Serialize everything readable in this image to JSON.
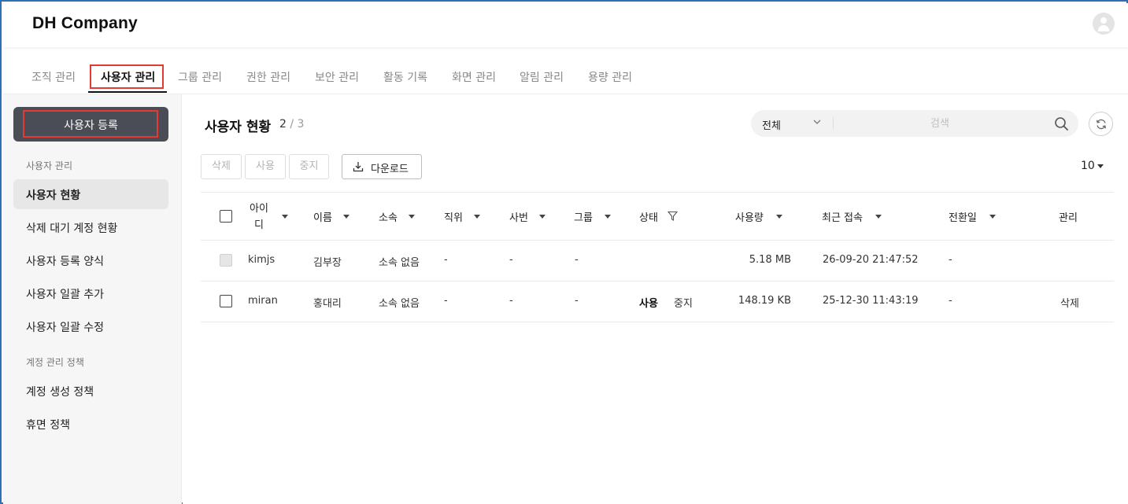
{
  "header": {
    "company": "DH Company"
  },
  "tabs": [
    {
      "label": "조직 관리"
    },
    {
      "label": "사용자 관리"
    },
    {
      "label": "그룹 관리"
    },
    {
      "label": "권한 관리"
    },
    {
      "label": "보안 관리"
    },
    {
      "label": "활동 기록"
    },
    {
      "label": "화면 관리"
    },
    {
      "label": "알림 관리"
    },
    {
      "label": "용량 관리"
    }
  ],
  "sidebar": {
    "register_button": "사용자 등록",
    "section1": "사용자 관리",
    "items1": [
      {
        "label": "사용자 현황"
      },
      {
        "label": "삭제 대기 계정 현황"
      },
      {
        "label": "사용자 등록 양식"
      },
      {
        "label": "사용자 일괄 추가"
      },
      {
        "label": "사용자 일괄 수정"
      }
    ],
    "section2": "계정 관리 정책",
    "items2": [
      {
        "label": "계정 생성 정책"
      },
      {
        "label": "휴면 정책"
      }
    ]
  },
  "main": {
    "title": "사용자 현황",
    "count_current": "2",
    "count_total": "/ 3",
    "search": {
      "filter_value": "전체",
      "placeholder": "검색"
    },
    "toolbar": {
      "delete_label": "삭제",
      "enable_label": "사용",
      "suspend_label": "중지",
      "download_label": "다운로드",
      "page_size": "10"
    },
    "table": {
      "columns": {
        "id_line1": "아이",
        "id_line2": "디",
        "name": "이름",
        "affiliation": "소속",
        "position": "직위",
        "employee_no": "사번",
        "group": "그룹",
        "status": "상태",
        "usage": "사용량",
        "last_access": "최근 접속",
        "transition_date": "전환일",
        "manage": "관리"
      },
      "rows": [
        {
          "id": "kimjs",
          "name": "김부장",
          "affiliation": "소속 없음",
          "position": "-",
          "employee_no": "-",
          "group": "-",
          "status": "",
          "status_action": "",
          "usage": "5.18 MB",
          "last_access": "26-09-20 21:47:52",
          "transition_date": "-",
          "manage": "",
          "checkbox_disabled": true
        },
        {
          "id": "miran",
          "name": "홍대리",
          "affiliation": "소속 없음",
          "position": "-",
          "employee_no": "-",
          "group": "-",
          "status": "사용",
          "status_action": "중지",
          "usage": "148.19 KB",
          "last_access": "25-12-30 11:43:19",
          "transition_date": "-",
          "manage": "삭제",
          "checkbox_disabled": false
        }
      ]
    }
  },
  "colors": {
    "highlight": "#e53935",
    "sidebar_button": "#4a4d55",
    "frame": "#2f6fb5"
  }
}
